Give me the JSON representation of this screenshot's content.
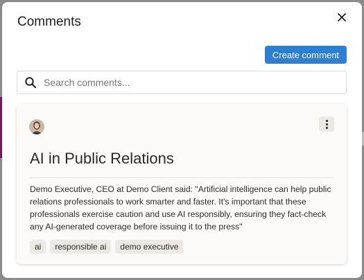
{
  "modal": {
    "title": "Comments",
    "close_icon": "close-icon"
  },
  "toolbar": {
    "create_label": "Create comment"
  },
  "search": {
    "placeholder": "Search comments...",
    "value": "",
    "icon": "search-icon"
  },
  "comments": [
    {
      "avatar_icon": "avatar",
      "menu_icon": "more-vertical-icon",
      "title": "AI in Public Relations",
      "body": "Demo Executive, CEO at Demo Client said: \"Artificial intelligence can help public relations professionals to work smarter and faster. It's important that these professionals exercise caution and use AI responsibly, ensuring they fact-check any AI-generated coverage before issuing it to the press\"",
      "tags": [
        "ai",
        "responsible ai",
        "demo executive"
      ]
    }
  ],
  "colors": {
    "primary_button": "#2f7fd0",
    "card_background": "#fcfaf8",
    "tag_background": "#ece9e5"
  }
}
